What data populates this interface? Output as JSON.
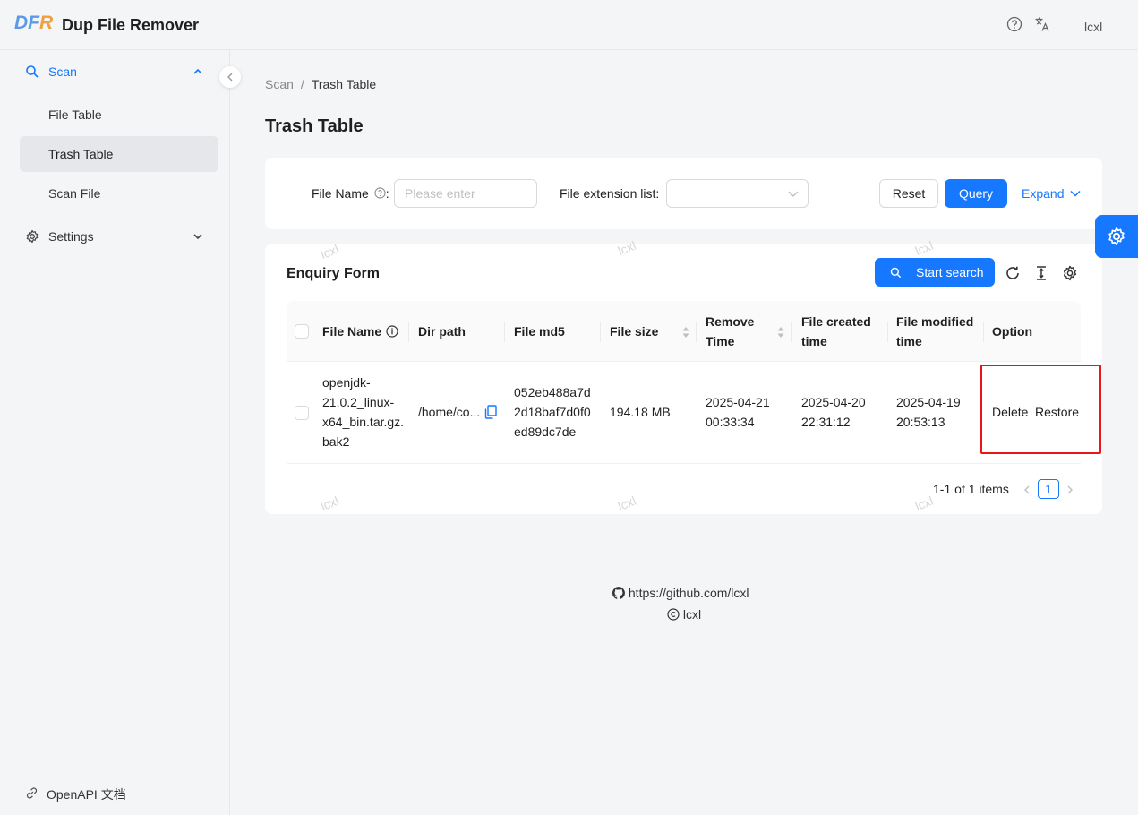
{
  "header": {
    "logo_d": "DF",
    "logo_r": "R",
    "app_title": "Dup File Remover",
    "user": "lcxl"
  },
  "sidebar": {
    "scan": {
      "label": "Scan",
      "icon": "search-icon"
    },
    "items": [
      {
        "label": "File Table"
      },
      {
        "label": "Trash Table",
        "active": true
      },
      {
        "label": "Scan File"
      }
    ],
    "settings": {
      "label": "Settings",
      "icon": "gear-icon"
    },
    "openapi": {
      "label": "OpenAPI 文档",
      "icon": "link-icon"
    }
  },
  "breadcrumb": {
    "parent": "Scan",
    "separator": "/",
    "current": "Trash Table"
  },
  "page_title": "Trash Table",
  "filter": {
    "file_name_label": "File Name",
    "file_name_placeholder": "Please enter",
    "ext_label": "File extension list",
    "colon": ":",
    "reset": "Reset",
    "query": "Query",
    "expand": "Expand"
  },
  "table": {
    "title": "Enquiry Form",
    "start_search": "Start search",
    "columns": {
      "file_name": "File Name",
      "dir_path": "Dir path",
      "file_md5": "File md5",
      "file_size": "File size",
      "remove_time_1": "Remove",
      "remove_time_2": "Time",
      "created_1": "File created",
      "created_2": "time",
      "modified_1": "File modified",
      "modified_2": "time",
      "option": "Option"
    },
    "rows": [
      {
        "file_name_lines": [
          "openjdk-",
          "21.0.2_linux-",
          "x64_bin.tar.gz.",
          "bak2"
        ],
        "dir_path": "/home/co...",
        "md5_lines": [
          "052eb488a7d",
          "2d18baf7d0f0",
          "ed89dc7de"
        ],
        "size": "194.18 MB",
        "remove_date": "2025-04-21",
        "remove_time": "00:33:34",
        "created_date": "2025-04-20",
        "created_time": "22:31:12",
        "modified_date": "2025-04-19",
        "modified_time": "20:53:13",
        "delete": "Delete",
        "restore": "Restore"
      }
    ],
    "pagination": {
      "summary": "1-1 of 1 items",
      "current": "1"
    }
  },
  "watermark": "lcxl",
  "footer": {
    "link": "https://github.com/lcxl",
    "copyright": "lcxl"
  },
  "colors": {
    "primary": "#1677ff",
    "highlight": "#e8161a"
  }
}
